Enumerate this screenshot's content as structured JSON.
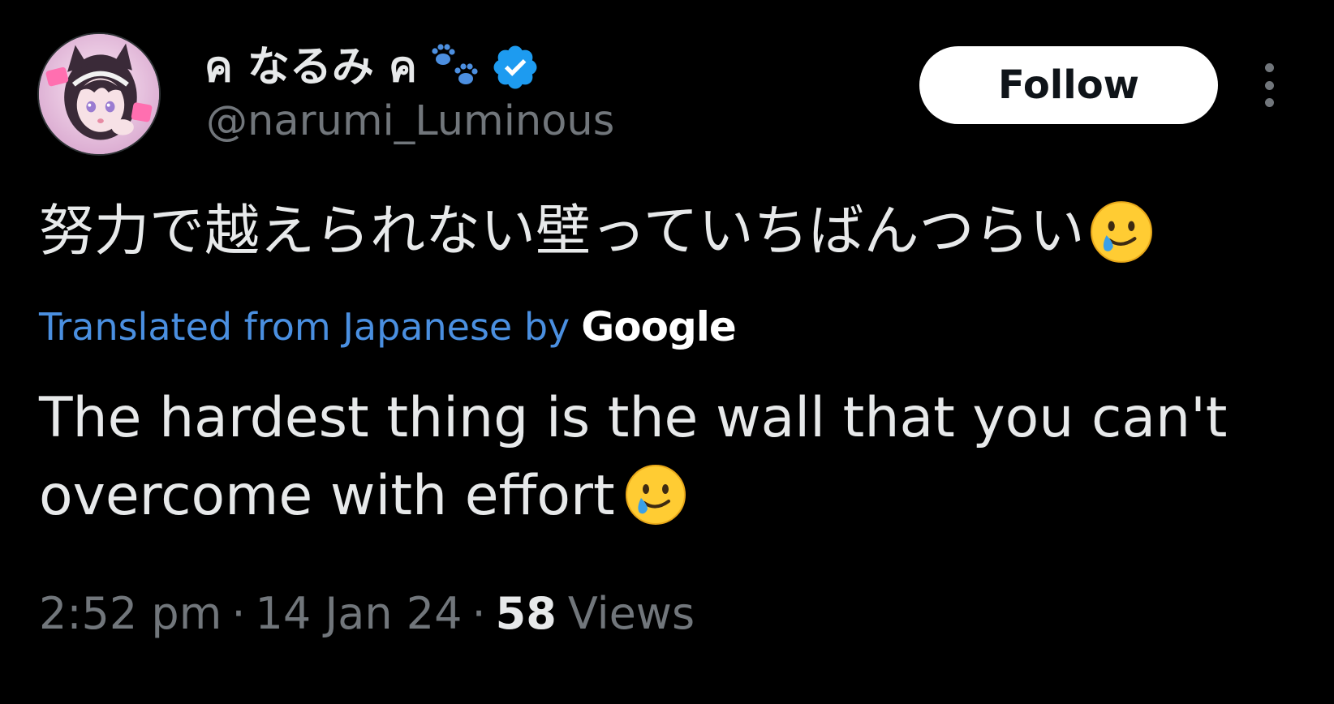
{
  "author": {
    "display_name": "ค なるみ ค",
    "handle": "@narumi_Luminous",
    "verified": true
  },
  "actions": {
    "follow_label": "Follow"
  },
  "tweet": {
    "original_text": "努力で越えられない壁っていちばんつらい",
    "translation_label": "Translated from Japanese by",
    "translation_provider": "Google",
    "translated_text": "The hardest thing is the wall that you can't overcome with effort",
    "emoji": "smiling-face-with-tear-icon"
  },
  "meta": {
    "time": "2:52 pm",
    "date": "14 Jan 24",
    "separator": "·",
    "views_count": "58",
    "views_label": "Views"
  },
  "colors": {
    "background": "#000000",
    "text_primary": "#e7e9ea",
    "text_secondary": "#71767b",
    "link": "#4a8fe0",
    "verified": "#1d9bf0",
    "follow_bg": "#ffffff"
  }
}
